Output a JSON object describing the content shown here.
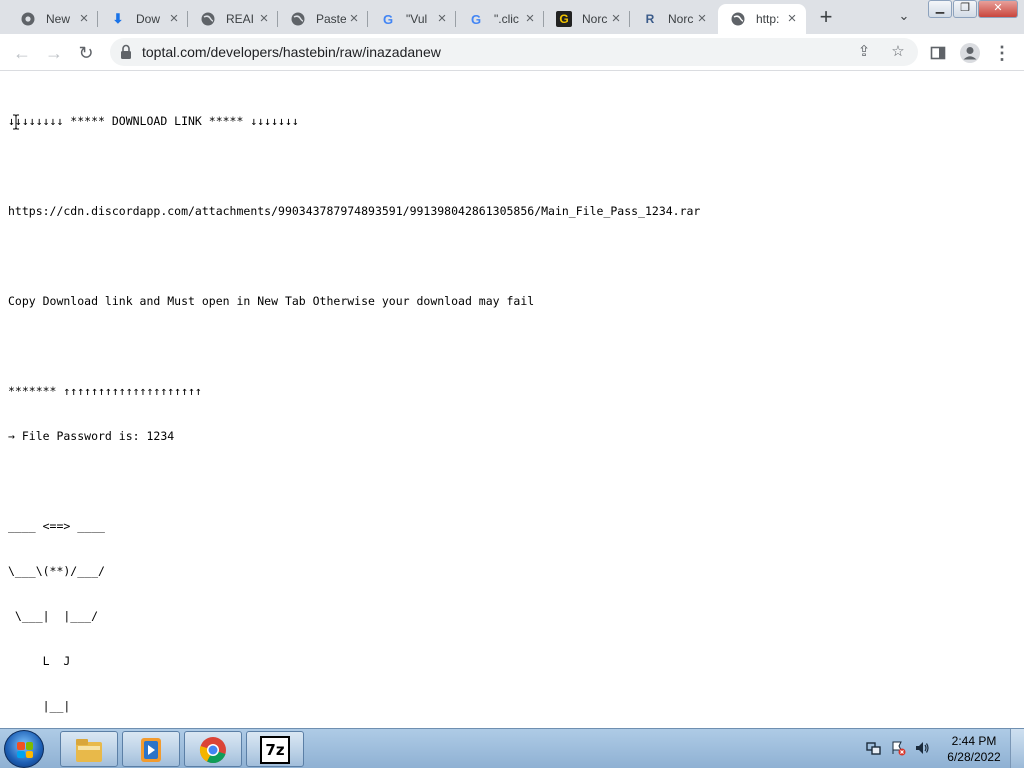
{
  "browser": {
    "tabs": [
      {
        "title": "New",
        "icon": "chrome-icon"
      },
      {
        "title": "Dow",
        "icon": "download-icon"
      },
      {
        "title": "REAI",
        "icon": "globe-icon"
      },
      {
        "title": "Paste",
        "icon": "globe-icon"
      },
      {
        "title": "\"Vul",
        "icon": "google-icon"
      },
      {
        "title": "\".clic",
        "icon": "google-icon"
      },
      {
        "title": "Norc",
        "icon": "g-logo-icon"
      },
      {
        "title": "Norc",
        "icon": "r-logo-icon"
      },
      {
        "title": "http:",
        "icon": "globe-icon",
        "active": true
      }
    ],
    "url": "toptal.com/developers/hastebin/raw/inazadanew"
  },
  "page": {
    "lines": [
      "↓↓↓↓↓↓↓↓ ***** DOWNLOAD LINK ***** ↓↓↓↓↓↓↓",
      "",
      "https://cdn.discordapp.com/attachments/990343787974893591/991398042861305856/Main_File_Pass_1234.rar",
      "",
      "Copy Download link and Must open in New Tab Otherwise your download may fail",
      "",
      "******* ↑↑↑↑↑↑↑↑↑↑↑↑↑↑↑↑↑↑↑↑",
      "→ File Password is: 1234",
      "",
      "____ <==> ____",
      "\\___\\(**)/___/",
      " \\___|  |___/",
      "     L  J",
      "     |__|"
    ]
  },
  "taskbar": {
    "apps": [
      "file-explorer",
      "media-player",
      "chrome",
      "7-zip"
    ],
    "app7z_label": "7z",
    "time": "2:44 PM",
    "date": "6/28/2022"
  },
  "colors": {
    "tabstrip": "#dee1e6",
    "omnibox": "#f1f3f4",
    "taskbar": "#8fb1d3"
  }
}
